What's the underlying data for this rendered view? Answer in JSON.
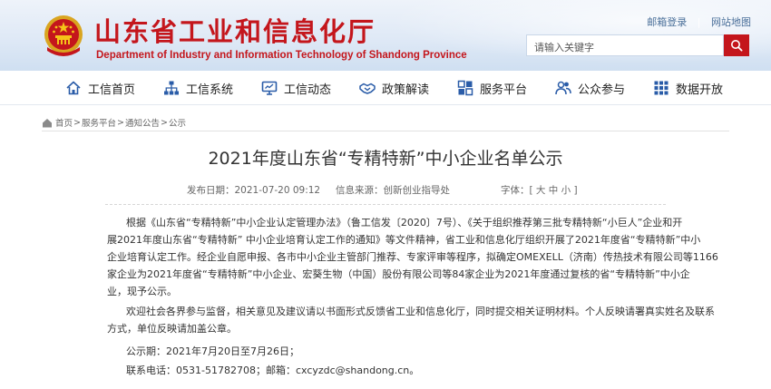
{
  "header": {
    "title": "山东省工业和信息化厅",
    "subtitle": "Department of Industry and Information Technology of Shandong Province",
    "top_links": [
      "邮箱登录",
      "网站地图"
    ],
    "search_placeholder": "请输入关键字"
  },
  "nav": {
    "items": [
      {
        "label": "工信首页",
        "icon": "home-icon"
      },
      {
        "label": "工信系统",
        "icon": "org-chart-icon"
      },
      {
        "label": "工信动态",
        "icon": "monitor-icon"
      },
      {
        "label": "政策解读",
        "icon": "handshake-icon"
      },
      {
        "label": "服务平台",
        "icon": "services-icon"
      },
      {
        "label": "公众参与",
        "icon": "users-icon"
      },
      {
        "label": "数据开放",
        "icon": "grid-icon"
      }
    ]
  },
  "breadcrumb": [
    "首页",
    "服务平台",
    "通知公告",
    "公示"
  ],
  "article": {
    "title": "2021年度山东省“专精特新”中小企业名单公示",
    "publish_date": "发布日期：2021-07-20 09:12",
    "source": "信息来源：创新创业指导处",
    "font_size_label": "字体：",
    "font_sizes": "[ 大 中 小 ]",
    "para1_lines": [
      "根据《山东省“专精特新”中小企业认定管理办法》（鲁工信发〔2020〕7号）、《关于组织推荐第三批专精特新“小巨人”企业和开",
      "展2021年度山东省“专精特新” 中小企业培育认定工作的通知》等文件精神，省工业和信息化厅组织开展了2021年度省“专精特新”中小",
      "企业培育认定工作。经企业自愿申报、各市中小企业主管部门推荐、专家评审等程序，拟确定OMEXELL（济南）传热技术有限公司等1166",
      "家企业为2021年度省“专精特新”中小企业、宏葵生物（中国）股份有限公司等84家企业为2021年度通过复核的省“专精特新”中小企",
      "业，现予公示。"
    ],
    "para2_lines": [
      "欢迎社会各界参与监督，相关意见及建议请以书面形式反馈省工业和信息化厅，同时提交相关证明材料。个人反映请署真实姓名及联系",
      "方式，单位反映请加盖公章。"
    ],
    "period": "公示期：2021年7月20日至7月26日；",
    "contact": "联系电话：0531-51782708；邮箱：cxcyzdc@shandong.cn。"
  },
  "colors": {
    "brand_red": "#c4161c",
    "nav_icon_blue": "#2a5ca8",
    "header_bg": "#dfe9f6"
  }
}
